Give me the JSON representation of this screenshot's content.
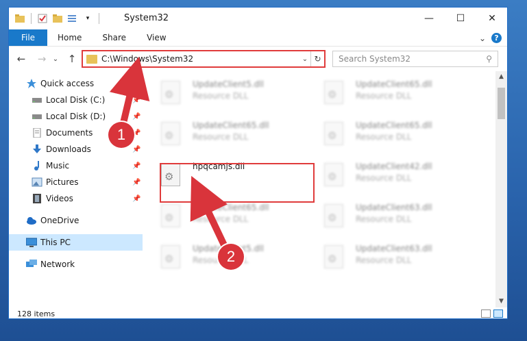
{
  "window": {
    "title": "System32",
    "controls": {
      "minimize": "—",
      "maximize": "☐",
      "close": "✕"
    }
  },
  "ribbon": {
    "tabs": [
      "File",
      "Home",
      "Share",
      "View"
    ],
    "expand_glyph": "⌄",
    "help_glyph": "?"
  },
  "navigation": {
    "back_glyph": "←",
    "forward_glyph": "→",
    "recent_glyph": "⌄",
    "up_glyph": "↑",
    "address_path": "C:\\Windows\\System32",
    "address_dropdown_glyph": "⌄",
    "refresh_glyph": "↻",
    "search_placeholder": "Search System32",
    "search_icon_glyph": "⚲"
  },
  "sidebar": {
    "items": [
      {
        "label": "Quick access",
        "icon": "star-icon"
      },
      {
        "label": "Local Disk (C:)",
        "icon": "drive-icon",
        "pinned": true
      },
      {
        "label": "Local Disk (D:)",
        "icon": "drive-icon",
        "pinned": true
      },
      {
        "label": "Documents",
        "icon": "documents-icon",
        "pinned": true
      },
      {
        "label": "Downloads",
        "icon": "download-icon",
        "pinned": true
      },
      {
        "label": "Music",
        "icon": "music-icon",
        "pinned": true
      },
      {
        "label": "Pictures",
        "icon": "pictures-icon",
        "pinned": true
      },
      {
        "label": "Videos",
        "icon": "videos-icon",
        "pinned": true
      },
      {
        "label": "OneDrive",
        "icon": "cloud-icon"
      },
      {
        "label": "This PC",
        "icon": "computer-icon",
        "selected": true
      },
      {
        "label": "Network",
        "icon": "network-icon"
      }
    ],
    "pin_glyph": "📌"
  },
  "files": [
    {
      "name": "UpdateClient5.dll",
      "type": "Resource DLL"
    },
    {
      "name": "UpdateClient65.dll",
      "type": "Resource DLL"
    },
    {
      "name": "UpdateClient65.dll",
      "type": "Resource DLL"
    },
    {
      "name": "UpdateClient65.dll",
      "type": "Resource DLL"
    },
    {
      "name": "hpqcamjs.dll",
      "type": ""
    },
    {
      "name": "UpdateClient42.dll",
      "type": "Resource DLL"
    },
    {
      "name": "UpdateClient65.dll",
      "type": "Resource DLL"
    },
    {
      "name": "UpdateClient63.dll",
      "type": "Resource DLL"
    },
    {
      "name": "UpdateClient5.dll",
      "type": "Resource DLL"
    },
    {
      "name": "UpdateClient63.dll",
      "type": "Resource DLL"
    }
  ],
  "statusbar": {
    "item_count": "128 items"
  },
  "annotations": {
    "marker_1": "1",
    "marker_2": "2",
    "color": "#d9343b"
  },
  "colors": {
    "accent": "#1979ca",
    "highlight_border": "#e03b3b",
    "selection": "#cce8ff"
  }
}
